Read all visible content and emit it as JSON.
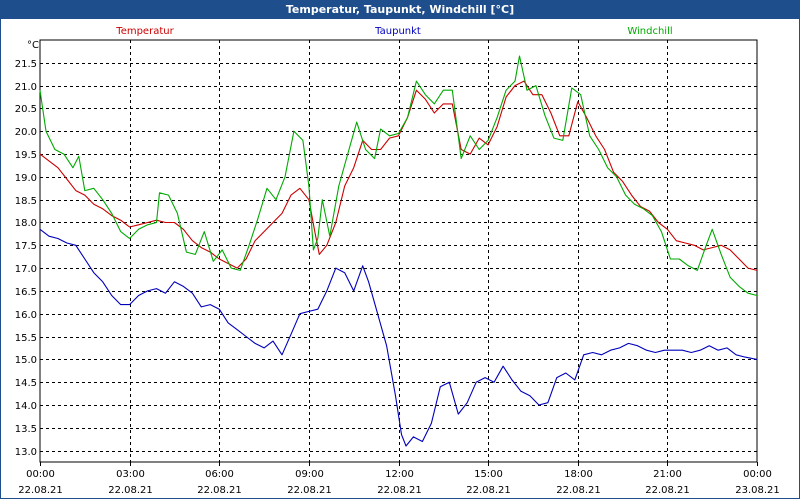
{
  "window": {
    "title": "Temperatur, Taupunkt, Windchill [°C]"
  },
  "chart_data": {
    "type": "line",
    "ylabel": "°C",
    "ylim": [
      12.75,
      22.0
    ],
    "yticks": [
      13.0,
      13.5,
      14.0,
      14.5,
      15.0,
      15.5,
      16.0,
      16.5,
      17.0,
      17.5,
      18.0,
      18.5,
      19.0,
      19.5,
      20.0,
      20.5,
      21.0,
      21.5
    ],
    "xlim": [
      0,
      24
    ],
    "xticks": [
      {
        "h": 0,
        "time": "00:00",
        "date": "22.08.21"
      },
      {
        "h": 3,
        "time": "03:00",
        "date": "22.08.21"
      },
      {
        "h": 6,
        "time": "06:00",
        "date": "22.08.21"
      },
      {
        "h": 9,
        "time": "09:00",
        "date": "22.08.21"
      },
      {
        "h": 12,
        "time": "12:00",
        "date": "22.08.21"
      },
      {
        "h": 15,
        "time": "15:00",
        "date": "22.08.21"
      },
      {
        "h": 18,
        "time": "18:00",
        "date": "22.08.21"
      },
      {
        "h": 21,
        "time": "21:00",
        "date": "22.08.21"
      },
      {
        "h": 24,
        "time": "00:00",
        "date": "23.08.21"
      }
    ],
    "grid": true,
    "series": [
      {
        "name": "Temperatur",
        "color": "#cc0000",
        "points": [
          [
            0,
            19.5
          ],
          [
            0.3,
            19.35
          ],
          [
            0.6,
            19.2
          ],
          [
            0.9,
            18.95
          ],
          [
            1.2,
            18.7
          ],
          [
            1.5,
            18.6
          ],
          [
            1.8,
            18.4
          ],
          [
            2.1,
            18.3
          ],
          [
            2.4,
            18.15
          ],
          [
            2.7,
            18.05
          ],
          [
            3.0,
            17.9
          ],
          [
            3.3,
            17.95
          ],
          [
            3.6,
            18.0
          ],
          [
            3.9,
            18.05
          ],
          [
            4.2,
            18.0
          ],
          [
            4.5,
            18.0
          ],
          [
            4.8,
            17.85
          ],
          [
            5.1,
            17.6
          ],
          [
            5.4,
            17.45
          ],
          [
            5.7,
            17.35
          ],
          [
            6.0,
            17.2
          ],
          [
            6.3,
            17.1
          ],
          [
            6.6,
            17.0
          ],
          [
            6.9,
            17.2
          ],
          [
            7.2,
            17.6
          ],
          [
            7.5,
            17.8
          ],
          [
            7.8,
            18.0
          ],
          [
            8.1,
            18.2
          ],
          [
            8.4,
            18.6
          ],
          [
            8.7,
            18.75
          ],
          [
            9.0,
            18.5
          ],
          [
            9.2,
            17.8
          ],
          [
            9.35,
            17.3
          ],
          [
            9.6,
            17.5
          ],
          [
            9.9,
            18.0
          ],
          [
            10.2,
            18.8
          ],
          [
            10.5,
            19.2
          ],
          [
            10.8,
            19.8
          ],
          [
            11.1,
            19.6
          ],
          [
            11.4,
            19.6
          ],
          [
            11.7,
            19.85
          ],
          [
            12.0,
            19.9
          ],
          [
            12.3,
            20.3
          ],
          [
            12.6,
            20.9
          ],
          [
            12.9,
            20.7
          ],
          [
            13.2,
            20.4
          ],
          [
            13.5,
            20.6
          ],
          [
            13.8,
            20.6
          ],
          [
            14.1,
            19.6
          ],
          [
            14.4,
            19.5
          ],
          [
            14.7,
            19.85
          ],
          [
            15.0,
            19.7
          ],
          [
            15.3,
            20.1
          ],
          [
            15.6,
            20.75
          ],
          [
            15.9,
            21.0
          ],
          [
            16.2,
            21.1
          ],
          [
            16.5,
            20.8
          ],
          [
            16.8,
            20.8
          ],
          [
            17.1,
            20.4
          ],
          [
            17.4,
            19.9
          ],
          [
            17.7,
            19.9
          ],
          [
            18.0,
            20.65
          ],
          [
            18.3,
            20.3
          ],
          [
            18.6,
            19.9
          ],
          [
            18.9,
            19.6
          ],
          [
            19.2,
            19.1
          ],
          [
            19.5,
            18.9
          ],
          [
            19.8,
            18.6
          ],
          [
            20.1,
            18.35
          ],
          [
            20.4,
            18.25
          ],
          [
            20.7,
            18.0
          ],
          [
            21.0,
            17.85
          ],
          [
            21.3,
            17.6
          ],
          [
            21.6,
            17.55
          ],
          [
            21.9,
            17.5
          ],
          [
            22.2,
            17.4
          ],
          [
            22.5,
            17.45
          ],
          [
            22.8,
            17.5
          ],
          [
            23.1,
            17.4
          ],
          [
            23.4,
            17.2
          ],
          [
            23.7,
            17.0
          ],
          [
            24.0,
            16.95
          ]
        ]
      },
      {
        "name": "Taupunkt",
        "color": "#0000bb",
        "points": [
          [
            0,
            17.85
          ],
          [
            0.3,
            17.7
          ],
          [
            0.6,
            17.65
          ],
          [
            0.9,
            17.55
          ],
          [
            1.2,
            17.5
          ],
          [
            1.5,
            17.2
          ],
          [
            1.8,
            16.9
          ],
          [
            2.1,
            16.7
          ],
          [
            2.4,
            16.4
          ],
          [
            2.7,
            16.2
          ],
          [
            3.0,
            16.2
          ],
          [
            3.3,
            16.4
          ],
          [
            3.6,
            16.5
          ],
          [
            3.9,
            16.55
          ],
          [
            4.2,
            16.45
          ],
          [
            4.5,
            16.7
          ],
          [
            4.8,
            16.6
          ],
          [
            5.1,
            16.45
          ],
          [
            5.4,
            16.15
          ],
          [
            5.7,
            16.2
          ],
          [
            6.0,
            16.1
          ],
          [
            6.3,
            15.8
          ],
          [
            6.6,
            15.65
          ],
          [
            6.9,
            15.5
          ],
          [
            7.2,
            15.35
          ],
          [
            7.5,
            15.25
          ],
          [
            7.8,
            15.4
          ],
          [
            8.1,
            15.1
          ],
          [
            8.4,
            15.55
          ],
          [
            8.7,
            16.0
          ],
          [
            9.0,
            16.05
          ],
          [
            9.3,
            16.1
          ],
          [
            9.6,
            16.5
          ],
          [
            9.9,
            17.0
          ],
          [
            10.2,
            16.9
          ],
          [
            10.5,
            16.5
          ],
          [
            10.8,
            17.05
          ],
          [
            11.0,
            16.7
          ],
          [
            11.3,
            16.0
          ],
          [
            11.6,
            15.3
          ],
          [
            11.9,
            14.2
          ],
          [
            12.1,
            13.35
          ],
          [
            12.25,
            13.1
          ],
          [
            12.5,
            13.3
          ],
          [
            12.8,
            13.2
          ],
          [
            13.1,
            13.6
          ],
          [
            13.4,
            14.4
          ],
          [
            13.7,
            14.5
          ],
          [
            14.0,
            13.8
          ],
          [
            14.3,
            14.05
          ],
          [
            14.6,
            14.5
          ],
          [
            14.9,
            14.6
          ],
          [
            15.2,
            14.5
          ],
          [
            15.5,
            14.85
          ],
          [
            15.8,
            14.55
          ],
          [
            16.1,
            14.3
          ],
          [
            16.4,
            14.2
          ],
          [
            16.7,
            14.0
          ],
          [
            17.0,
            14.05
          ],
          [
            17.3,
            14.6
          ],
          [
            17.6,
            14.7
          ],
          [
            17.9,
            14.55
          ],
          [
            18.2,
            15.1
          ],
          [
            18.5,
            15.15
          ],
          [
            18.8,
            15.1
          ],
          [
            19.1,
            15.2
          ],
          [
            19.4,
            15.25
          ],
          [
            19.7,
            15.35
          ],
          [
            20.0,
            15.3
          ],
          [
            20.3,
            15.2
          ],
          [
            20.6,
            15.15
          ],
          [
            20.9,
            15.2
          ],
          [
            21.2,
            15.2
          ],
          [
            21.5,
            15.2
          ],
          [
            21.8,
            15.15
          ],
          [
            22.1,
            15.2
          ],
          [
            22.4,
            15.3
          ],
          [
            22.7,
            15.2
          ],
          [
            23.0,
            15.25
          ],
          [
            23.3,
            15.1
          ],
          [
            23.6,
            15.05
          ],
          [
            24.0,
            15.0
          ]
        ]
      },
      {
        "name": "Windchill",
        "color": "#00aa00",
        "points": [
          [
            0,
            20.9
          ],
          [
            0.2,
            20.0
          ],
          [
            0.5,
            19.6
          ],
          [
            0.8,
            19.5
          ],
          [
            1.1,
            19.2
          ],
          [
            1.3,
            19.45
          ],
          [
            1.5,
            18.7
          ],
          [
            1.8,
            18.75
          ],
          [
            2.1,
            18.5
          ],
          [
            2.4,
            18.2
          ],
          [
            2.7,
            17.8
          ],
          [
            3.0,
            17.65
          ],
          [
            3.3,
            17.85
          ],
          [
            3.6,
            17.95
          ],
          [
            3.9,
            18.0
          ],
          [
            4.0,
            18.65
          ],
          [
            4.3,
            18.6
          ],
          [
            4.6,
            18.2
          ],
          [
            4.9,
            17.35
          ],
          [
            5.2,
            17.3
          ],
          [
            5.5,
            17.8
          ],
          [
            5.8,
            17.15
          ],
          [
            6.1,
            17.4
          ],
          [
            6.4,
            17.0
          ],
          [
            6.7,
            16.95
          ],
          [
            7.0,
            17.5
          ],
          [
            7.3,
            18.1
          ],
          [
            7.6,
            18.75
          ],
          [
            7.9,
            18.5
          ],
          [
            8.2,
            19.0
          ],
          [
            8.5,
            20.0
          ],
          [
            8.8,
            19.8
          ],
          [
            9.0,
            18.8
          ],
          [
            9.15,
            17.4
          ],
          [
            9.3,
            17.65
          ],
          [
            9.45,
            18.5
          ],
          [
            9.7,
            17.7
          ],
          [
            10.0,
            18.8
          ],
          [
            10.3,
            19.5
          ],
          [
            10.6,
            20.2
          ],
          [
            10.9,
            19.6
          ],
          [
            11.2,
            19.4
          ],
          [
            11.4,
            20.05
          ],
          [
            11.7,
            19.9
          ],
          [
            12.0,
            19.95
          ],
          [
            12.3,
            20.3
          ],
          [
            12.6,
            21.1
          ],
          [
            12.9,
            20.8
          ],
          [
            13.2,
            20.6
          ],
          [
            13.5,
            20.9
          ],
          [
            13.8,
            20.9
          ],
          [
            14.1,
            19.4
          ],
          [
            14.4,
            19.9
          ],
          [
            14.7,
            19.6
          ],
          [
            15.0,
            19.8
          ],
          [
            15.3,
            20.3
          ],
          [
            15.6,
            20.9
          ],
          [
            15.9,
            21.1
          ],
          [
            16.05,
            21.65
          ],
          [
            16.3,
            20.9
          ],
          [
            16.6,
            21.0
          ],
          [
            16.9,
            20.35
          ],
          [
            17.2,
            19.85
          ],
          [
            17.5,
            19.8
          ],
          [
            17.8,
            20.95
          ],
          [
            18.1,
            20.8
          ],
          [
            18.4,
            19.9
          ],
          [
            18.7,
            19.6
          ],
          [
            19.0,
            19.2
          ],
          [
            19.3,
            19.0
          ],
          [
            19.6,
            18.6
          ],
          [
            19.9,
            18.4
          ],
          [
            20.2,
            18.3
          ],
          [
            20.5,
            18.15
          ],
          [
            20.8,
            17.8
          ],
          [
            21.1,
            17.2
          ],
          [
            21.4,
            17.2
          ],
          [
            21.7,
            17.05
          ],
          [
            22.0,
            16.95
          ],
          [
            22.3,
            17.5
          ],
          [
            22.5,
            17.85
          ],
          [
            22.8,
            17.3
          ],
          [
            23.1,
            16.8
          ],
          [
            23.4,
            16.6
          ],
          [
            23.7,
            16.45
          ],
          [
            24.0,
            16.4
          ]
        ]
      }
    ]
  }
}
